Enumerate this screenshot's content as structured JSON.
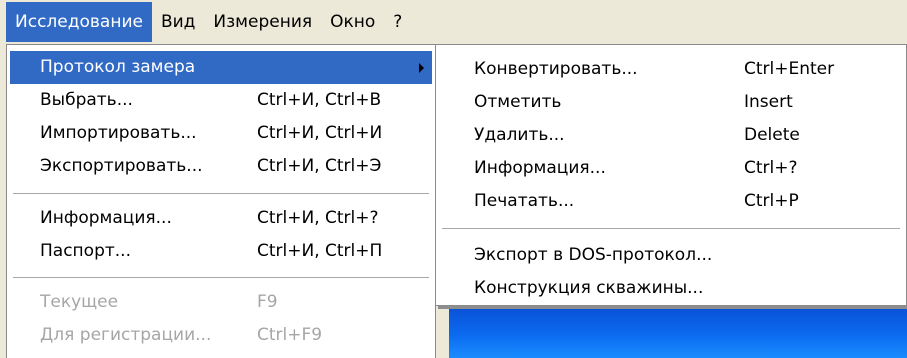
{
  "menubar": {
    "items": [
      {
        "label": "Исследование"
      },
      {
        "label": "Вид"
      },
      {
        "label": "Измерения"
      },
      {
        "label": "Окно"
      },
      {
        "label": "?"
      }
    ]
  },
  "primary_menu": {
    "items": [
      {
        "label": "Протокол замера",
        "shortcut": "",
        "has_submenu": true,
        "state": "highlighted"
      },
      {
        "label": "Выбрать...",
        "shortcut": "Ctrl+И, Ctrl+В"
      },
      {
        "label": "Импортировать...",
        "shortcut": "Ctrl+И, Ctrl+И"
      },
      {
        "label": "Экспортировать...",
        "shortcut": "Ctrl+И, Ctrl+Э"
      },
      {
        "label": "Информация...",
        "shortcut": "Ctrl+И, Ctrl+?"
      },
      {
        "label": "Паспорт...",
        "shortcut": "Ctrl+И, Ctrl+П"
      },
      {
        "label": "Текущее",
        "shortcut": "F9",
        "state": "disabled"
      },
      {
        "label": "Для регистрации...",
        "shortcut": "Ctrl+F9",
        "state": "disabled"
      }
    ]
  },
  "submenu": {
    "items": [
      {
        "label": "Конвертировать...",
        "shortcut": "Ctrl+Enter"
      },
      {
        "label": "Отметить",
        "shortcut": "Insert"
      },
      {
        "label": "Удалить...",
        "shortcut": "Delete"
      },
      {
        "label": "Информация...",
        "shortcut": "Ctrl+?"
      },
      {
        "label": "Печатать...",
        "shortcut": "Ctrl+P"
      },
      {
        "label": "Экспорт в DOS-протокол...",
        "shortcut": ""
      },
      {
        "label": "Конструкция скважины...",
        "shortcut": ""
      }
    ]
  },
  "colors": {
    "menubar_bg": "#ece9d8",
    "highlight": "#316ac5",
    "disabled_text": "#a6a6a6",
    "desktop_blue": "#0b6aef"
  }
}
